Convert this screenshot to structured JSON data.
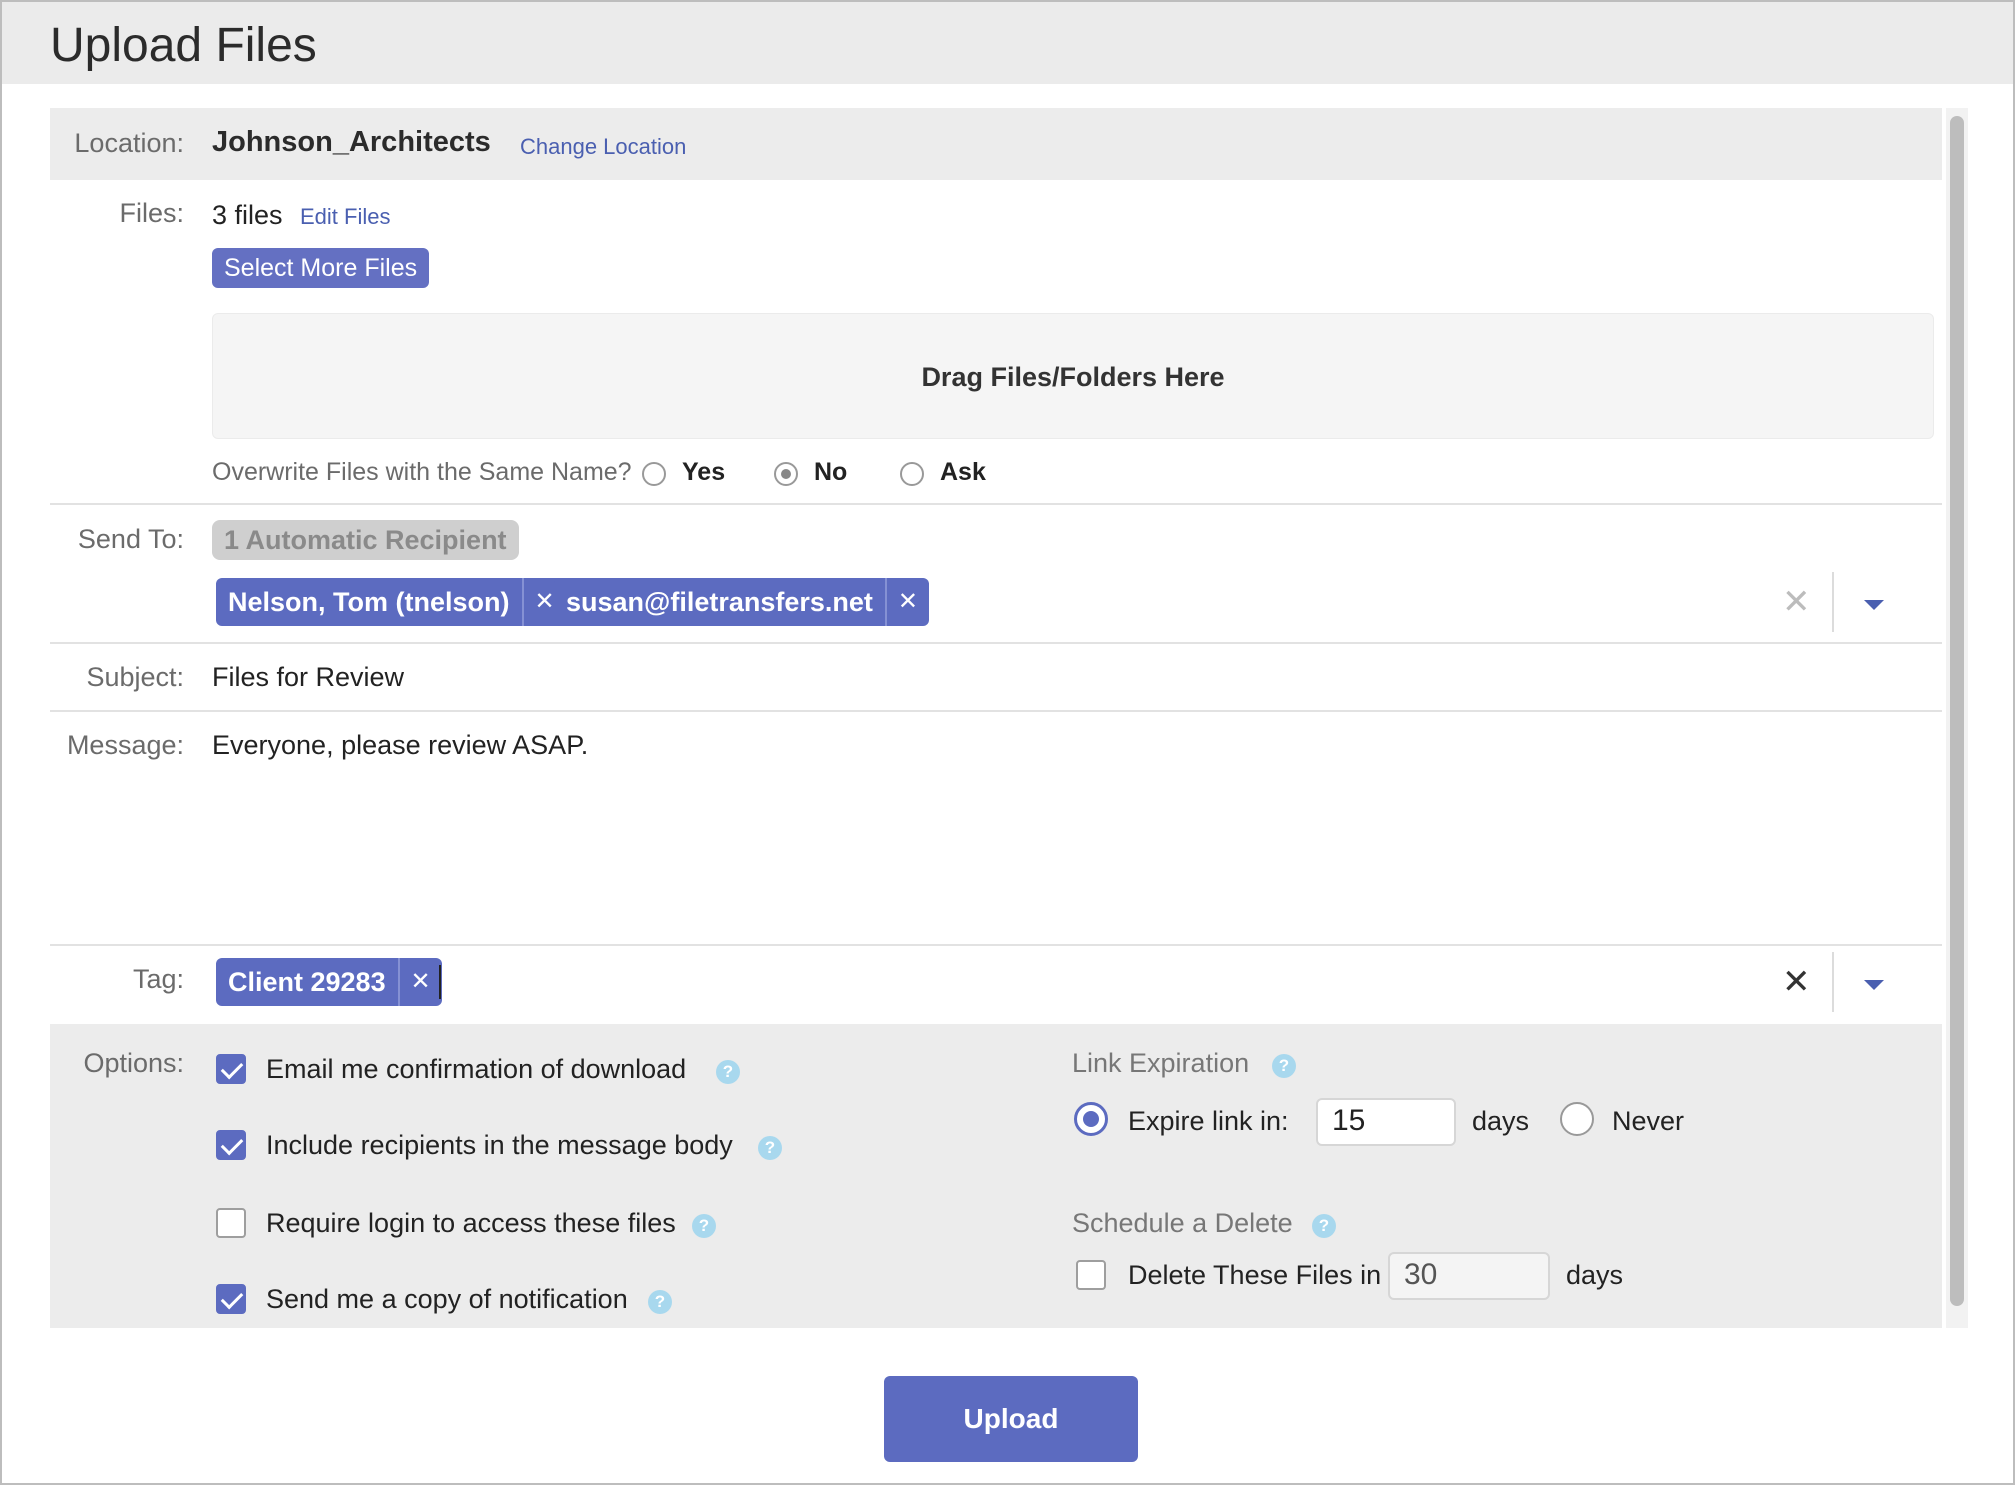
{
  "window": {
    "title": "Upload Files"
  },
  "location": {
    "label": "Location:",
    "value": "Johnson_Architects",
    "change_link": "Change Location"
  },
  "files": {
    "label": "Files:",
    "count": "3 files",
    "edit_link": "Edit Files",
    "select_more_button": "Select More Files",
    "dropzone_text": "Drag Files/Folders Here",
    "overwrite": {
      "question": "Overwrite Files with the Same Name?",
      "options": [
        "Yes",
        "No",
        "Ask"
      ],
      "selected": "No"
    }
  },
  "send_to": {
    "label": "Send To:",
    "automatic": "1 Automatic Recipient",
    "recipients": [
      "Nelson, Tom (tnelson)",
      "susan@filetransfers.net"
    ]
  },
  "subject": {
    "label": "Subject:",
    "value": "Files for Review"
  },
  "message": {
    "label": "Message:",
    "value": "Everyone, please review ASAP."
  },
  "tag": {
    "label": "Tag:",
    "tags": [
      "Client 29283"
    ]
  },
  "options": {
    "label": "Options:",
    "items": [
      {
        "text": "Email me confirmation of download",
        "checked": true
      },
      {
        "text": "Include recipients in the message body",
        "checked": true
      },
      {
        "text": "Require login to access these files",
        "checked": false
      },
      {
        "text": "Send me a copy of notification",
        "checked": true
      }
    ],
    "link_expiration": {
      "title": "Link Expiration",
      "expire_label": "Expire link in:",
      "expire_days": "15",
      "days_unit": "days",
      "never_label": "Never",
      "selected": "expire"
    },
    "schedule_delete": {
      "title": "Schedule a Delete",
      "checkbox_label": "Delete These Files in",
      "days": "30",
      "days_unit": "days",
      "checked": false
    }
  },
  "upload_button": "Upload",
  "colors": {
    "accent": "#5c6bc0",
    "link": "#4a5fb0",
    "help": "#a8d8ee"
  }
}
